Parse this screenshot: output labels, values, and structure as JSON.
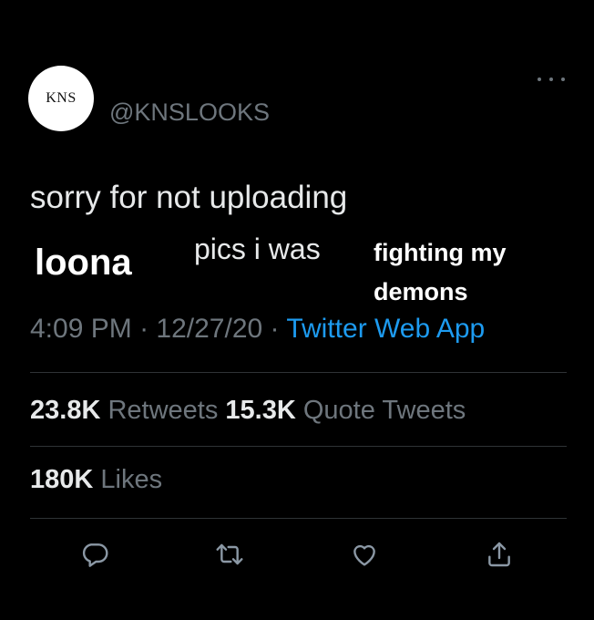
{
  "tweet": {
    "avatar_text": "KNS",
    "handle": "@KNSLOOKS",
    "text": {
      "line1": "sorry for not uploading",
      "loona": "loona",
      "pics": "pics i was",
      "fighting": "fighting my",
      "demons": "demons"
    },
    "meta": {
      "time": "4:09 PM",
      "sep1": "·",
      "date": "12/27/20",
      "sep2": "·",
      "source": "Twitter Web App"
    },
    "stats": {
      "retweets_count": "23.8K",
      "retweets_label": "Retweets",
      "quotes_count": "15.3K",
      "quotes_label": "Quote Tweets",
      "likes_count": "180K",
      "likes_label": "Likes"
    }
  },
  "actions": [
    {
      "icon": "reply-icon"
    },
    {
      "icon": "retweet-icon"
    },
    {
      "icon": "like-icon"
    },
    {
      "icon": "share-icon"
    }
  ],
  "colors": {
    "background": "#000000",
    "text": "#e7e9ea",
    "secondary": "#6e767d",
    "link": "#1d9bf0",
    "divider": "#2f3336"
  }
}
